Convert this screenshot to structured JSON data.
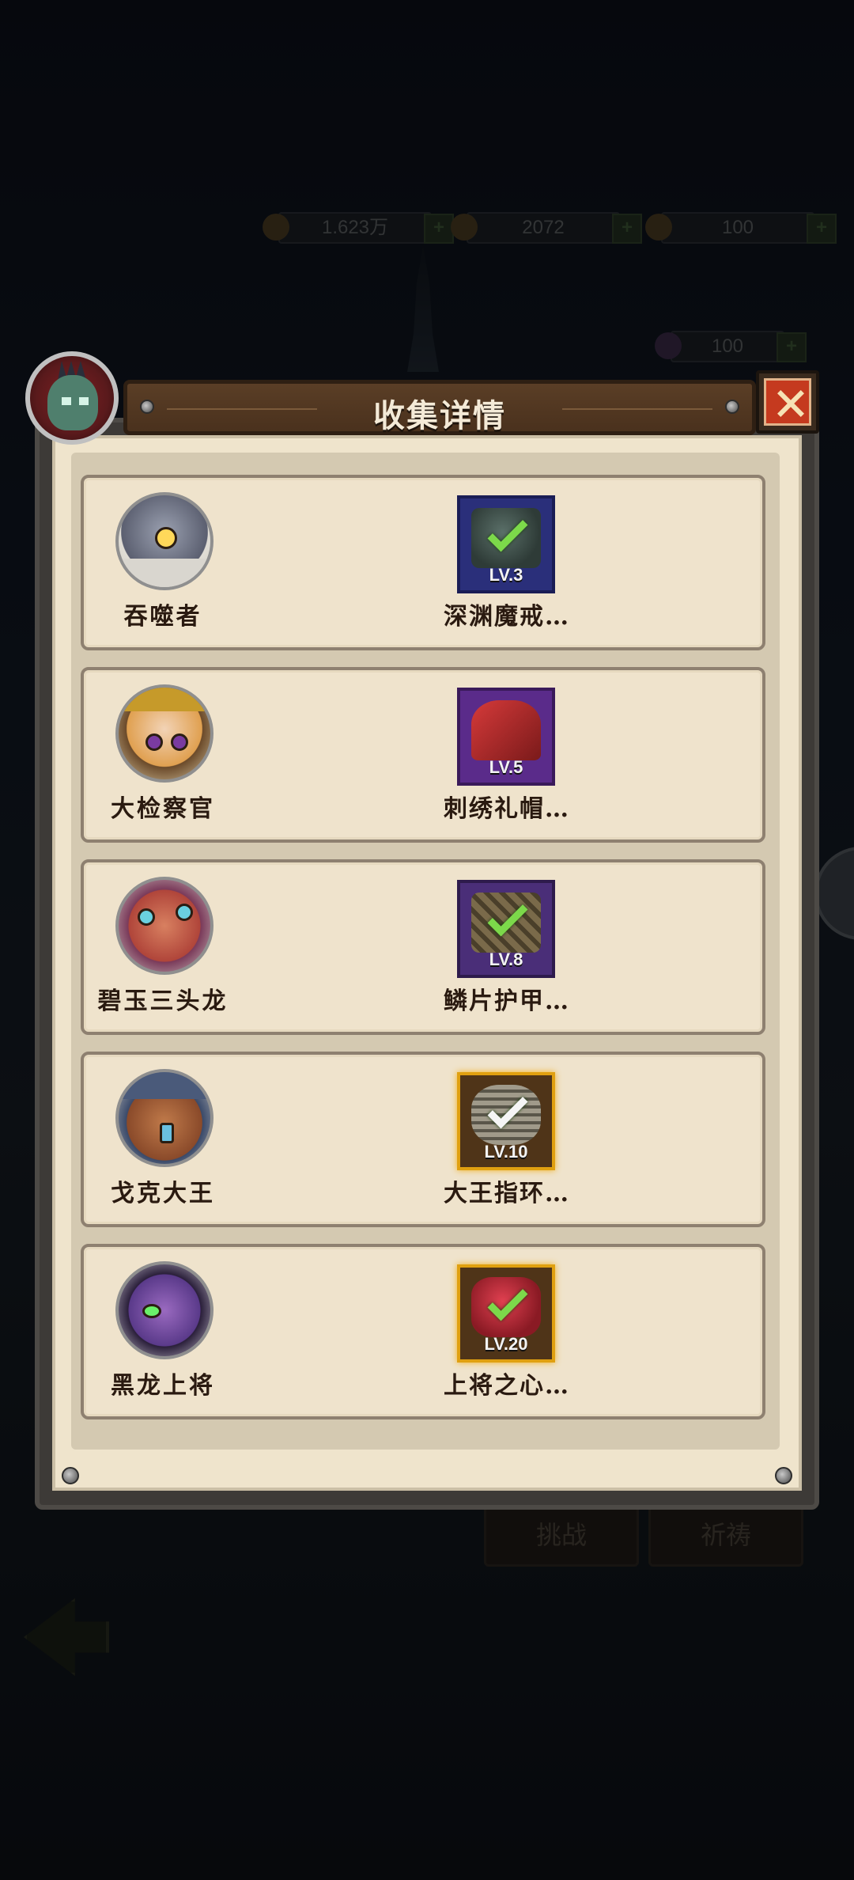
{
  "background": {
    "resources": [
      {
        "icon": "coin-icon",
        "value": "1.623万"
      },
      {
        "icon": "gem-icon",
        "value": "2072"
      },
      {
        "icon": "energy-icon",
        "value": "100"
      }
    ],
    "resource_extra": {
      "icon": "token-icon",
      "value": "100"
    },
    "buttons": {
      "challenge": "挑战",
      "pray": "祈祷"
    }
  },
  "modal": {
    "title": "收集详情",
    "close_icon": "close-icon",
    "entries": [
      {
        "hero_name": "吞噬者",
        "hero_icon": "devourer-portrait",
        "item_name": "深渊魔戒…",
        "item_level": "LV.3",
        "item_icon": "abyss-ring-icon",
        "rarity_color": "#2a2f7a",
        "collected": true
      },
      {
        "hero_name": "大检察官",
        "hero_icon": "inquisitor-portrait",
        "item_name": "刺绣礼帽…",
        "item_level": "LV.5",
        "item_icon": "embroidered-hat-icon",
        "rarity_color": "#5a2b8a",
        "collected": false
      },
      {
        "hero_name": "碧玉三头龙",
        "hero_icon": "jade-hydra-portrait",
        "item_name": "鳞片护甲…",
        "item_level": "LV.8",
        "item_icon": "scale-armor-icon",
        "rarity_color": "#4a2e78",
        "collected": true
      },
      {
        "hero_name": "戈克大王",
        "hero_icon": "king-gok-portrait",
        "item_name": "大王指环…",
        "item_level": "LV.10",
        "item_icon": "king-ring-icon",
        "rarity_color": "#4f3418",
        "collected": true
      },
      {
        "hero_name": "黑龙上将",
        "hero_icon": "black-dragon-general-portrait",
        "item_name": "上将之心…",
        "item_level": "LV.20",
        "item_icon": "general-heart-icon",
        "rarity_color": "#4f3418",
        "collected": true
      }
    ]
  }
}
